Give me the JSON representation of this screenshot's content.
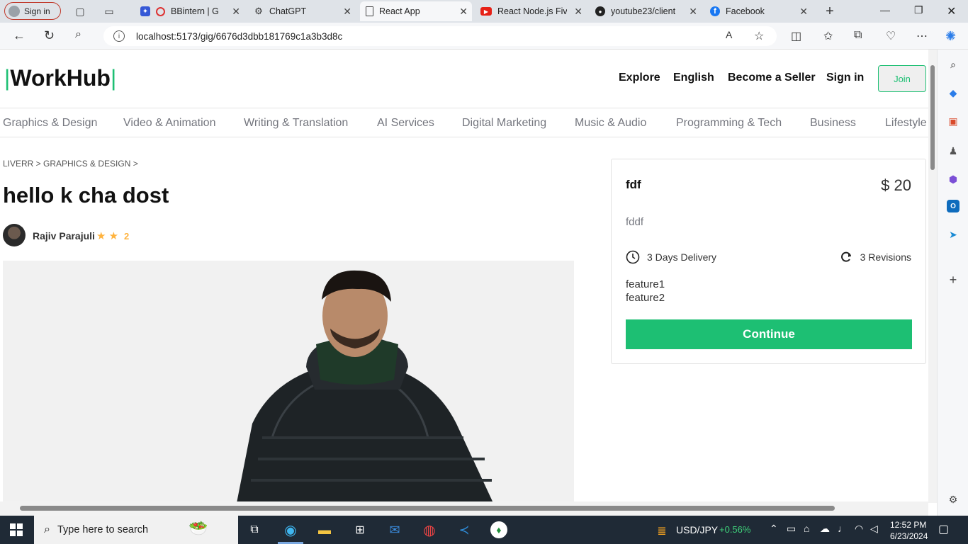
{
  "browser": {
    "profile_label": "Sign in",
    "tabs": [
      {
        "label": "BBintern | G",
        "icon": "recording-icon"
      },
      {
        "label": "ChatGPT",
        "icon": "chatgpt-icon"
      },
      {
        "label": "React App",
        "icon": "document-icon",
        "active": true
      },
      {
        "label": "React Node.js Fiver",
        "icon": "youtube-icon"
      },
      {
        "label": "youtube23/client",
        "icon": "github-icon"
      },
      {
        "label": "Facebook",
        "icon": "facebook-icon"
      }
    ],
    "url": "localhost:5173/gig/6676d3dbb181769c1a3b3d8c"
  },
  "site": {
    "logo": "WorkHub",
    "nav": {
      "explore": "Explore",
      "language": "English",
      "become_seller": "Become a Seller",
      "sign_in": "Sign in",
      "join": "Join"
    },
    "categories": [
      "Graphics & Design",
      "Video & Animation",
      "Writing & Translation",
      "AI Services",
      "Digital Marketing",
      "Music & Audio",
      "Programming & Tech",
      "Business",
      "Lifestyle"
    ]
  },
  "gig": {
    "breadcrumb": "LIVERR > GRAPHICS & DESIGN >",
    "title": "hello k cha dost",
    "seller_name": "Rajiv Parajuli",
    "stars": "★ ★",
    "rating": "2"
  },
  "price_card": {
    "title": "fdf",
    "price": "$ 20",
    "description": "fddf",
    "delivery": "3 Days Delivery",
    "revisions": "3 Revisions",
    "features": [
      "feature1",
      "feature2"
    ],
    "continue_label": "Continue"
  },
  "taskbar": {
    "search_placeholder": "Type here to search",
    "ticker": "USD/JPY",
    "ticker_change": "+0.56%",
    "time": "12:52 PM",
    "date": "6/23/2024"
  },
  "colors": {
    "brand_green": "#1dbf73",
    "star_yellow": "#ffb33e"
  }
}
